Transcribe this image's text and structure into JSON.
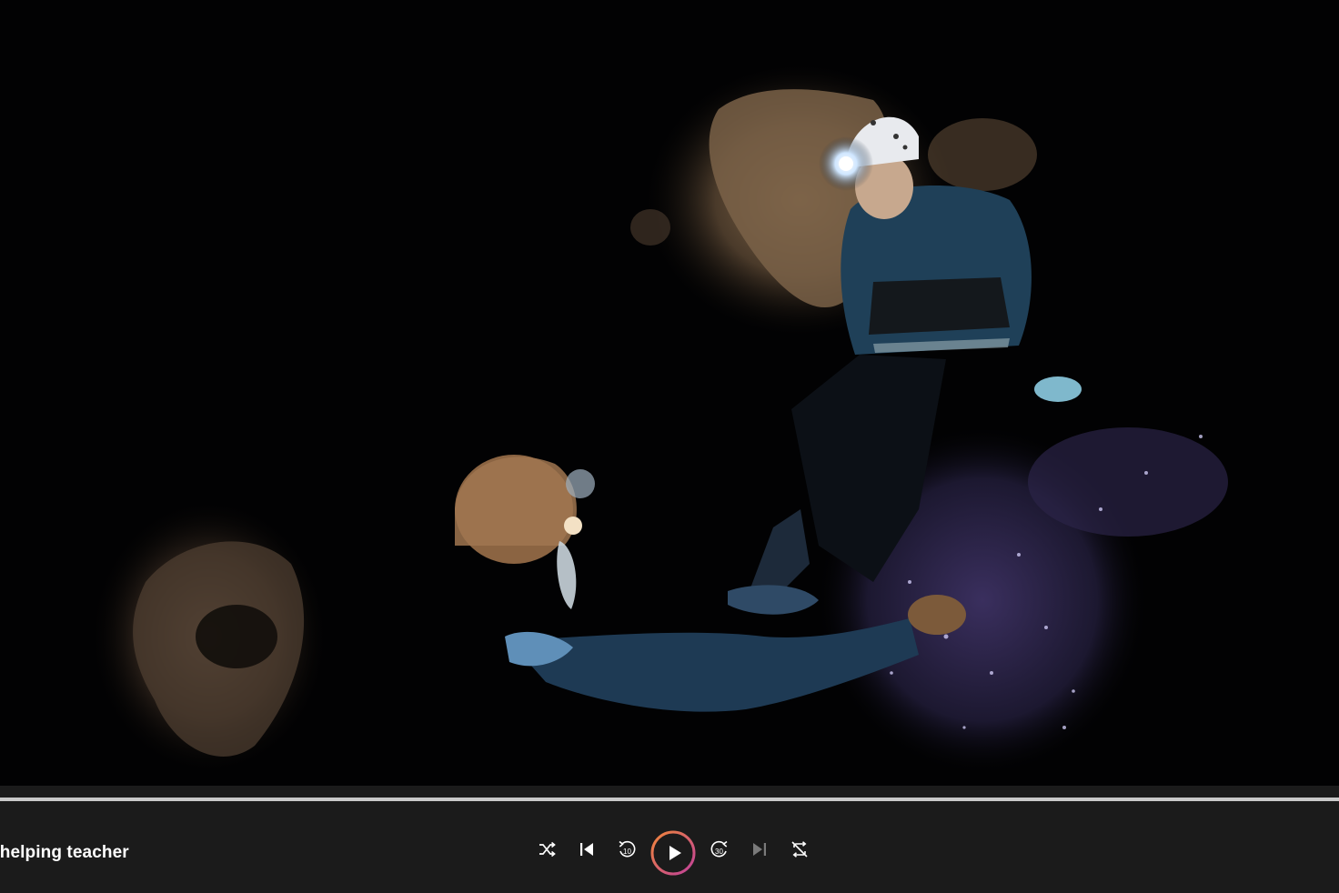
{
  "player": {
    "title": "t helping teacher",
    "progress_fraction": 1.0,
    "state": "paused"
  },
  "controls": {
    "shuffle_icon": "shuffle-icon",
    "previous_icon": "skip-previous-icon",
    "rewind_icon": "rewind-10-icon",
    "rewind_label": "10",
    "play_icon": "play-icon",
    "forward_icon": "forward-30-icon",
    "forward_label": "30",
    "next_icon": "skip-next-icon",
    "repeat_icon": "repeat-off-icon"
  },
  "colors": {
    "accent_start": "#f0863a",
    "accent_end": "#c0409a",
    "bar_background": "#1b1b1b"
  }
}
